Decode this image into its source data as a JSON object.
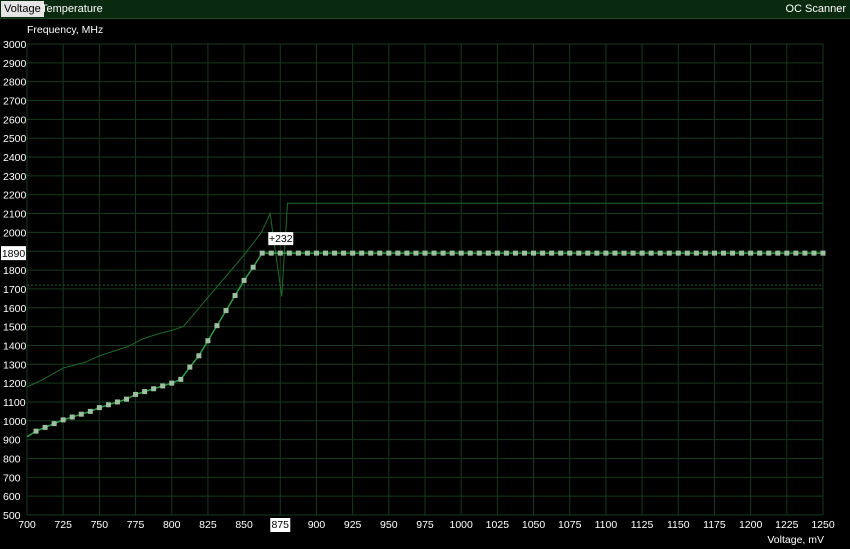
{
  "tabs": [
    {
      "label": "Voltage",
      "active": true
    },
    {
      "label": "Temperature",
      "active": false
    }
  ],
  "oc_scanner_label": "OC Scanner",
  "colors": {
    "background": "#000000",
    "grid": "#163a1c",
    "curve": "#2f9e44",
    "points": "#9fbfa3",
    "reference": "#1f6b2b",
    "limit_line": "#2e5a2e",
    "tab_bar": "#0a2a0f"
  },
  "chart_data": {
    "type": "line",
    "xlabel": "Voltage, mV",
    "ylabel": "Frequency, MHz",
    "xlim": [
      700,
      1250
    ],
    "ylim": [
      500,
      3000
    ],
    "x_ticks": [
      700,
      725,
      750,
      775,
      800,
      825,
      850,
      875,
      900,
      925,
      950,
      975,
      1000,
      1025,
      1050,
      1075,
      1100,
      1125,
      1150,
      1175,
      1200,
      1225,
      1250
    ],
    "y_ticks": [
      500,
      600,
      700,
      800,
      900,
      1000,
      1100,
      1200,
      1300,
      1400,
      1500,
      1600,
      1700,
      1800,
      1900,
      2000,
      2100,
      2200,
      2300,
      2400,
      2500,
      2600,
      2700,
      2800,
      2900,
      3000
    ],
    "grid": true,
    "highlight_x_label": "875",
    "highlight_y_label": "1890",
    "offset_label": "+232",
    "limit_line_y": 1720,
    "series": [
      {
        "role": "curve",
        "x": [
          700,
          706.25,
          712.5,
          718.75,
          725,
          731.25,
          737.5,
          743.75,
          750,
          756.25,
          762.5,
          768.75,
          775,
          781.25,
          787.5,
          793.75,
          800,
          806.25,
          812.5,
          818.75,
          825,
          831.25,
          837.5,
          843.75,
          850,
          856.25,
          862.5,
          868.75,
          875,
          881.25,
          887.5,
          893.75,
          900,
          906.25,
          912.5,
          918.75,
          925,
          931.25,
          937.5,
          943.75,
          950,
          956.25,
          962.5,
          968.75,
          975,
          981.25,
          987.5,
          993.75,
          1000,
          1006.25,
          1012.5,
          1018.75,
          1025,
          1031.25,
          1037.5,
          1043.75,
          1050,
          1056.25,
          1062.5,
          1068.75,
          1075,
          1081.25,
          1087.5,
          1093.75,
          1100,
          1106.25,
          1112.5,
          1118.75,
          1125,
          1131.25,
          1137.5,
          1143.75,
          1150,
          1156.25,
          1162.5,
          1168.75,
          1175,
          1181.25,
          1187.5,
          1193.75,
          1200,
          1206.25,
          1212.5,
          1218.75,
          1225,
          1231.25,
          1237.5,
          1243.75,
          1250
        ],
        "y": [
          915,
          945,
          965,
          985,
          1005,
          1020,
          1035,
          1050,
          1070,
          1085,
          1100,
          1115,
          1140,
          1155,
          1170,
          1185,
          1200,
          1220,
          1285,
          1345,
          1425,
          1505,
          1585,
          1665,
          1745,
          1815,
          1890,
          1890,
          1890,
          1890,
          1890,
          1890,
          1890,
          1890,
          1890,
          1890,
          1890,
          1890,
          1890,
          1890,
          1890,
          1890,
          1890,
          1890,
          1890,
          1890,
          1890,
          1890,
          1890,
          1890,
          1890,
          1890,
          1890,
          1890,
          1890,
          1890,
          1890,
          1890,
          1890,
          1890,
          1890,
          1890,
          1890,
          1890,
          1890,
          1890,
          1890,
          1890,
          1890,
          1890,
          1890,
          1890,
          1890,
          1890,
          1890,
          1890,
          1890,
          1890,
          1890,
          1890,
          1890,
          1890,
          1890,
          1890,
          1890,
          1890,
          1890,
          1890,
          1890
        ]
      },
      {
        "role": "reference",
        "x": [
          700,
          710,
          725,
          740,
          750,
          760,
          770,
          780,
          790,
          800,
          808,
          830,
          850,
          862,
          868,
          872,
          876,
          880,
          1250
        ],
        "y": [
          1180,
          1215,
          1280,
          1310,
          1345,
          1370,
          1395,
          1435,
          1460,
          1480,
          1500,
          1700,
          1880,
          2000,
          2100,
          1880,
          1660,
          2155,
          2155
        ]
      }
    ]
  }
}
